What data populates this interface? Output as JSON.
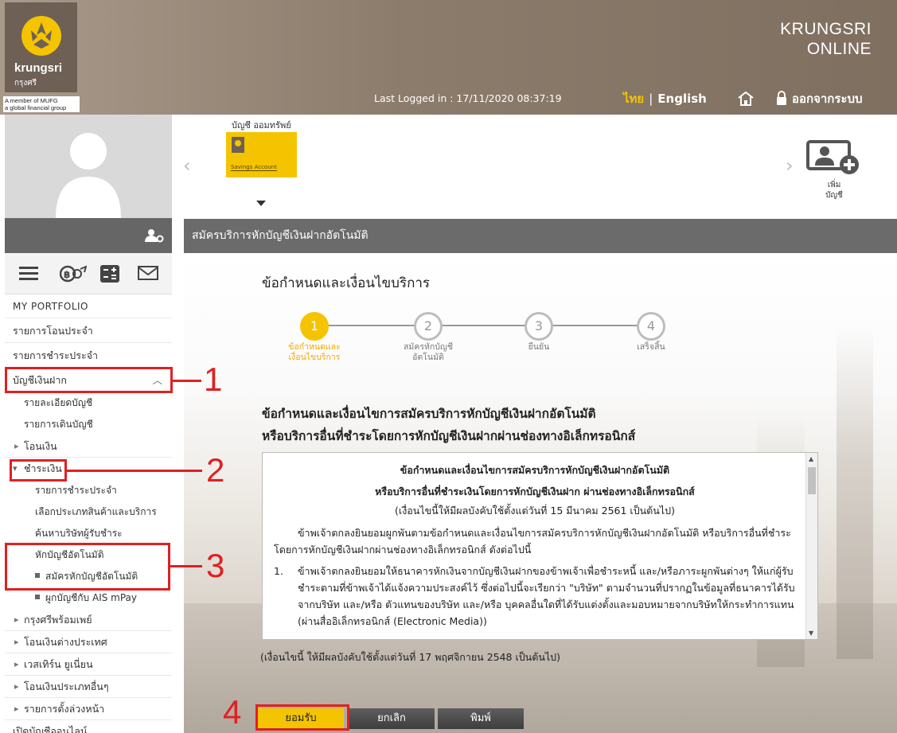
{
  "header": {
    "logo_name": "krungsri",
    "logo_thai": "กรุงศรี",
    "mufg_line1": "A member of MUFG",
    "mufg_line2": "a global financial group",
    "brand_line1": "KRUNGSRI",
    "brand_line2": "ONLINE",
    "last_login": "Last Logged in : 17/11/2020 08:37:19",
    "lang_th": "ไทย",
    "lang_sep": "|",
    "lang_en": "English",
    "logout": "ออกจากระบบ",
    "accent_color": "#f5c400"
  },
  "sidebar": {
    "portfolio": "MY PORTFOLIO",
    "items": [
      "รายการโอนประจำ",
      "รายการชำระประจำ",
      "บัญชีเงินฝาก",
      "รายละเอียดบัญชี",
      "รายการเดินบัญชี",
      "โอนเงิน",
      "ชำระเงิน",
      "รายการชำระประจำ",
      "เลือกประเภทสินค้าและบริการ",
      "ค้นหาบริษัทผู้รับชำระ",
      "หักบัญชีอัตโนมัติ",
      "สมัครหักบัญชีอัตโนมัติ",
      "ผูกบัญชีกับ AIS mPay",
      "กรุงศรีพร้อมเพย์",
      "โอนเงินต่างประเทศ",
      "เวสเทิร์น ยูเนี่ยน",
      "โอนเงินประเภทอื่นๆ",
      "รายการตั้งล่วงหน้า",
      "เปิดบัญชีออนไลน์"
    ]
  },
  "accounts": {
    "label": "บัญชี ออมทรัพย์",
    "card_tag": "Savings Account",
    "add_label_1": "เพิ่ม",
    "add_label_2": "บัญชี"
  },
  "page": {
    "bar_title": "สมัครบริการหักบัญชีเงินฝากอัตโนมัติ",
    "section_title": "ข้อกำหนดและเงื่อนไขบริการ",
    "steps": [
      {
        "num": "1",
        "l1": "ข้อกำหนดและ",
        "l2": "เงื่อนไขบริการ"
      },
      {
        "num": "2",
        "l1": "สมัครหักบัญชี",
        "l2": "อัตโนมัติ"
      },
      {
        "num": "3",
        "l1": "ยืนยัน",
        "l2": ""
      },
      {
        "num": "4",
        "l1": "เสร็จสิ้น",
        "l2": ""
      }
    ],
    "terms_head_1": "ข้อกำหนดและเงื่อนไขการสมัครบริการหักบัญชีเงินฝากอัตโนมัติ",
    "terms_head_2": "หรือบริการอื่นที่ชำระโดยการหักบัญชีเงินฝากผ่านช่องทางอิเล็กทรอนิกส์",
    "box": {
      "t1": "ข้อกำหนดและเงื่อนไขการสมัครบริการหักบัญชีเงินฝากอัตโนมัติ",
      "t2": "หรือบริการอื่นที่ชำระเงินโดยการหักบัญชีเงินฝาก ผ่านช่องทางอิเล็กทรอนิกส์",
      "t3": "(เงื่อนไขนี้ให้มีผลบังคับใช้ตั้งแต่วันที่ 15 มีนาคม 2561 เป็นต้นไป)",
      "p1": "ข้าพเจ้าตกลงยินยอมผูกพันตามข้อกำหนดและเงื่อนไขการสมัครบริการหักบัญชีเงินฝากอัตโนมัติ หรือบริการอื่นที่ชำระโดยการหักบัญชีเงินฝากผ่านช่องทางอิเล็กทรอนิกส์ ดังต่อไปนี้",
      "n1_num": "1.",
      "n1": "ข้าพเจ้าตกลงยินยอมให้ธนาคารหักเงินจากบัญชีเงินฝากของข้าพเจ้าเพื่อชำระหนี้ และ/หรือภาระผูกพันต่างๆ ให้แก่ผู้รับชำระตามที่ข้าพเจ้าได้แจ้งความประสงค์ไว้ ซึ่งต่อไปนี้จะเรียกว่า \"บริษัท\" ตามจำนวนที่ปรากฏในข้อมูลที่ธนาคารได้รับจากบริษัท และ/หรือ ตัวแทนของบริษัท และ/หรือ บุคคลอื่นใดที่ได้รับแต่งตั้งและมอบหมายจากบริษัทให้กระทำการแทน (ผ่านสื่ออิเล็กทรอนิกส์ (Electronic Media))"
    },
    "note": "(เงื่อนไขนี้ ให้มีผลบังคับใช้ตั้งแต่วันที่ 17 พฤศจิกายน 2548 เป็นต้นไป)",
    "btn_accept": "ยอมรับ",
    "btn_cancel": "ยกเลิก",
    "btn_print": "พิมพ์"
  },
  "annotations": {
    "n1": "1",
    "n2": "2",
    "n3": "3",
    "n4": "4",
    "color": "#e02020"
  }
}
